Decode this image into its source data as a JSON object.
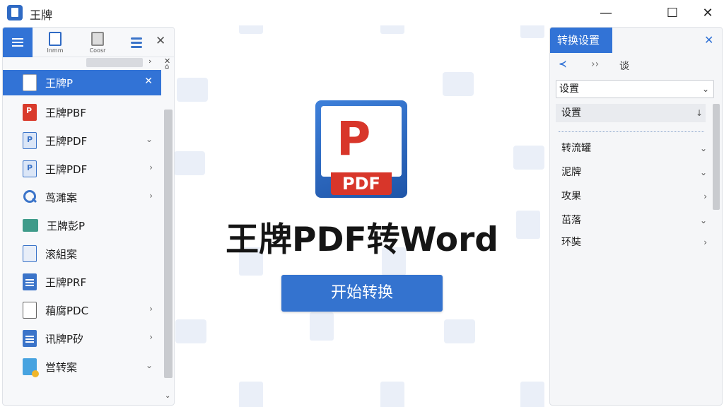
{
  "window": {
    "title": "王牌",
    "minimize_glyph": "—",
    "maximize_glyph": "☐",
    "close_glyph": "✕"
  },
  "left_panel": {
    "tools": [
      {
        "label": "Inmm",
        "icon": "document-icon"
      },
      {
        "label": "Coosr",
        "icon": "copy-icon"
      }
    ],
    "close_glyph": "✕",
    "nav_forward": "›",
    "nav_close": "✕",
    "scroll_up": "⌂",
    "scroll_down": "⌄",
    "files": [
      {
        "name": "王牌P",
        "icon": "document-icon",
        "kind": "doc",
        "chevron": "✕",
        "selected": true
      },
      {
        "name": "王牌PBF",
        "icon": "pdf-icon",
        "kind": "pdf",
        "chevron": ""
      },
      {
        "name": "王牌PDF",
        "icon": "pdf-file-icon",
        "kind": "blue",
        "chevron": "⌄"
      },
      {
        "name": "王牌PDF",
        "icon": "convert-icon",
        "kind": "blue",
        "chevron": "›"
      },
      {
        "name": "茑濉案",
        "icon": "search-icon",
        "kind": "search",
        "chevron": "›"
      },
      {
        "name": "王牌彭P",
        "icon": "folder-icon",
        "kind": "folder",
        "chevron": ""
      },
      {
        "name": "滚組案",
        "icon": "wave-document-icon",
        "kind": "wave",
        "chevron": ""
      },
      {
        "name": "王牌PRF",
        "icon": "word-document-icon",
        "kind": "word",
        "chevron": ""
      },
      {
        "name": "葙腐PDC",
        "icon": "mail-icon",
        "kind": "mail",
        "chevron": "›"
      },
      {
        "name": "讯牌P矽",
        "icon": "word-document-icon",
        "kind": "word",
        "chevron": "›"
      },
      {
        "name": "営转案",
        "icon": "cloud-document-icon",
        "kind": "cloud",
        "chevron": "⌄"
      }
    ]
  },
  "center": {
    "logo_letter": "P",
    "logo_band_text": "PDF",
    "title": "王牌PDF转Word",
    "start_button": "开始转换"
  },
  "right_panel": {
    "title": "转换设置",
    "close_glyph": "✕",
    "tabs": [
      "≺",
      "››",
      "谈"
    ],
    "select_value": "设置",
    "select_chevron": "⌄",
    "section_label": "设置",
    "section_pin": "↓",
    "options": [
      {
        "label": "转流罐",
        "chevron": "⌄"
      },
      {
        "label": "泥牌",
        "chevron": "⌄"
      },
      {
        "label": "攻果",
        "chevron": "›"
      },
      {
        "label": "茁落",
        "chevron": "⌄"
      },
      {
        "label": "环奘",
        "chevron": "›"
      }
    ]
  },
  "colors": {
    "accent": "#3273d6",
    "logo_red": "#d8362a",
    "panel_bg": "#f7f8fa"
  }
}
